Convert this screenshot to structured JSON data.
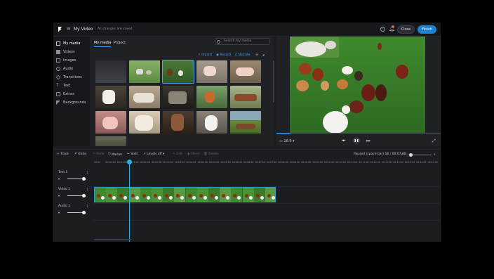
{
  "header": {
    "app_title": "My Video",
    "save_status": "All changes are saved",
    "close_label": "Close",
    "finish_label": "Finish"
  },
  "nav": {
    "items": [
      {
        "label": "My media",
        "icon": "my-media-icon"
      },
      {
        "label": "Videos",
        "icon": "videos-icon"
      },
      {
        "label": "Images",
        "icon": "images-icon"
      },
      {
        "label": "Audio",
        "icon": "audio-icon"
      },
      {
        "label": "Transitions",
        "icon": "transitions-icon"
      },
      {
        "label": "Text",
        "icon": "text-icon"
      },
      {
        "label": "Extras",
        "icon": "extras-icon"
      },
      {
        "label": "Backgrounds",
        "icon": "backgrounds-icon"
      }
    ]
  },
  "media": {
    "tabs": [
      "My media",
      "Project"
    ],
    "search_placeholder": "Search my media",
    "actions": [
      "Import",
      "Record",
      "Narrate"
    ]
  },
  "preview": {
    "ratio_label": "16:9"
  },
  "timeline": {
    "tools": [
      "+ Track",
      "Undo",
      "Redo",
      "Marker",
      "Split",
      "Levels off",
      "Edit",
      "Filters",
      "Delete"
    ],
    "time_display": "Paused (space bar) 16 / 00:07.88",
    "ruler": [
      "00:00",
      "00:00.50",
      "00:01.00",
      "00:01.50",
      "00:02.00",
      "00:02.50",
      "00:03.00",
      "00:03.50",
      "00:04.00",
      "00:04.50",
      "00:05.00",
      "00:05.50",
      "00:06.00",
      "00:06.50",
      "00:07.00",
      "00:07.50",
      "00:08.00",
      "00:08.50",
      "00:09.00",
      "00:09.50",
      "00:10.00",
      "00:10.50",
      "00:11.00",
      "00:11.50",
      "00:12.00",
      "00:12.50",
      "00:13.00",
      "00:13.50",
      "00:14.00",
      "00:14.50"
    ],
    "tracks": [
      {
        "name": "Text 1",
        "num": "1"
      },
      {
        "name": "Video 1",
        "num": "1"
      },
      {
        "name": "Audio 1",
        "num": "1"
      }
    ]
  },
  "colors": {
    "accent": "#1d82d2",
    "playhead": "#2ab0e0"
  }
}
